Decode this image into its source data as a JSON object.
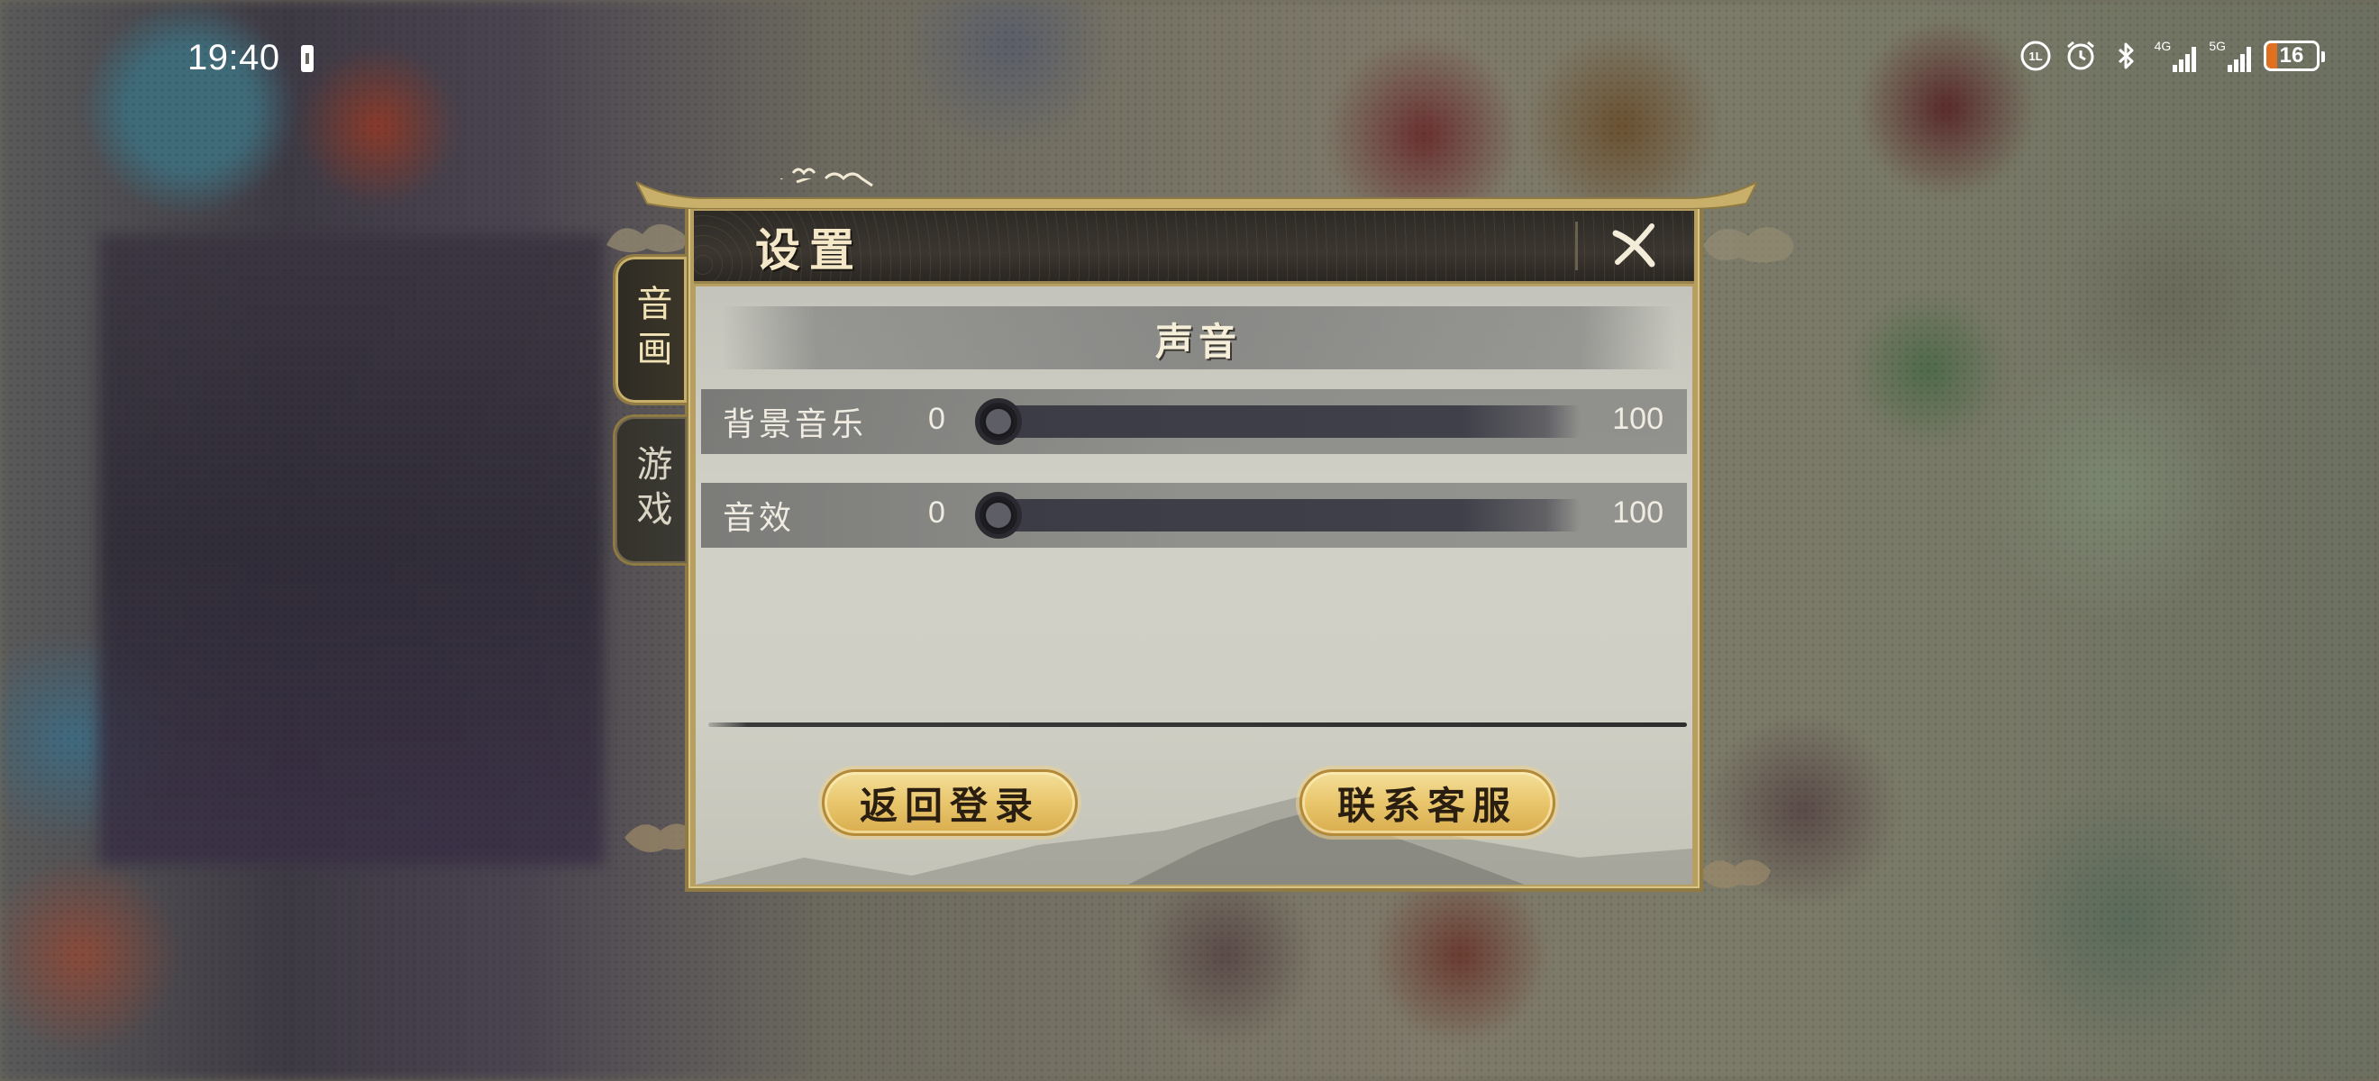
{
  "status_bar": {
    "time": "19:40",
    "network_1": "4G",
    "network_2": "5G",
    "battery_level": "16"
  },
  "dialog": {
    "title": "设置",
    "tabs": [
      {
        "label": "音画",
        "active": true
      },
      {
        "label": "游戏",
        "active": false
      }
    ],
    "section_title": "声音",
    "sliders": [
      {
        "label": "背景音乐",
        "min": "0",
        "max": "100",
        "value": 0
      },
      {
        "label": "音效",
        "min": "0",
        "max": "100",
        "value": 0
      }
    ],
    "buttons": {
      "back_to_login": "返回登录",
      "contact_support": "联系客服"
    }
  },
  "colors": {
    "frame_gold": "#b79f62",
    "header_dark": "#2d2a26",
    "button_gold": "#e9c66c",
    "battery_low": "#e07020"
  }
}
